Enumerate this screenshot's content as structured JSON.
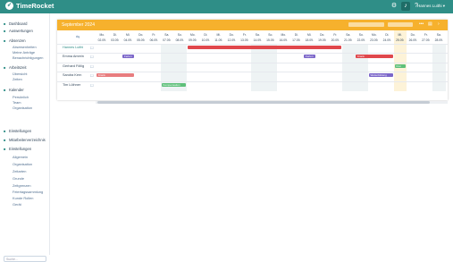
{
  "app": {
    "name": "TimeRocket",
    "user": "Hannes Luithi"
  },
  "sidebar": {
    "items": [
      {
        "label": "Dashboard",
        "icon": "home-icon",
        "sub": false
      },
      {
        "label": "Auswertungen",
        "icon": "chart-icon",
        "sub": false
      },
      {
        "label": "Absenzen",
        "icon": "calendar-icon",
        "sub": false
      },
      {
        "label": "Abwesenheiten",
        "icon": "",
        "sub": true
      },
      {
        "label": "Meine Anträge",
        "icon": "",
        "sub": true
      },
      {
        "label": "Benachrichtigungen",
        "icon": "",
        "sub": true
      },
      {
        "label": "Arbeitszeit",
        "icon": "clock-icon",
        "sub": false
      },
      {
        "label": "Übersicht",
        "icon": "",
        "sub": true
      },
      {
        "label": "Zeiten",
        "icon": "",
        "sub": true
      },
      {
        "label": "Kalender",
        "icon": "calendar-icon",
        "sub": false
      },
      {
        "label": "Persönlich",
        "icon": "",
        "sub": true
      },
      {
        "label": "Team",
        "icon": "",
        "sub": true
      },
      {
        "label": "Organisation",
        "icon": "",
        "sub": true
      },
      {
        "label": "Einstellungen",
        "icon": "settings-icon",
        "sub": false
      },
      {
        "label": "Mitarbeiterverzeichnis",
        "icon": "users-icon",
        "sub": false
      },
      {
        "label": "Einstellungen",
        "icon": "gear-icon",
        "sub": false
      },
      {
        "label": "Allgemein",
        "icon": "",
        "sub": true
      },
      {
        "label": "Organisation",
        "icon": "",
        "sub": true
      },
      {
        "label": "Zeitarten",
        "icon": "",
        "sub": true
      },
      {
        "label": "Grunde",
        "icon": "",
        "sub": true
      },
      {
        "label": "Zeitgrenzen",
        "icon": "",
        "sub": true
      },
      {
        "label": "Feiertagssammlung",
        "icon": "",
        "sub": true
      },
      {
        "label": "Kunde Rollen",
        "icon": "",
        "sub": true
      },
      {
        "label": "Gerät",
        "icon": "",
        "sub": true
      }
    ],
    "search_placeholder": "Suche..."
  },
  "calendar": {
    "month": "September 2024",
    "days": [
      {
        "wd": "Mo.",
        "d": "02.09."
      },
      {
        "wd": "Di.",
        "d": "03.09."
      },
      {
        "wd": "Mi.",
        "d": "04.09."
      },
      {
        "wd": "Do.",
        "d": "05.09."
      },
      {
        "wd": "Fr.",
        "d": "06.09."
      },
      {
        "wd": "Sa.",
        "d": "07.09."
      },
      {
        "wd": "So.",
        "d": "08.09."
      },
      {
        "wd": "Mo.",
        "d": "09.09."
      },
      {
        "wd": "Di.",
        "d": "10.09."
      },
      {
        "wd": "Mi.",
        "d": "11.09."
      },
      {
        "wd": "Do.",
        "d": "12.09."
      },
      {
        "wd": "Fr.",
        "d": "13.09."
      },
      {
        "wd": "Sa.",
        "d": "14.09."
      },
      {
        "wd": "So.",
        "d": "15.09."
      },
      {
        "wd": "Mo.",
        "d": "16.09."
      },
      {
        "wd": "Di.",
        "d": "17.09."
      },
      {
        "wd": "Mi.",
        "d": "18.09."
      },
      {
        "wd": "Do.",
        "d": "19.09."
      },
      {
        "wd": "Fr.",
        "d": "20.09."
      },
      {
        "wd": "Sa.",
        "d": "21.09."
      },
      {
        "wd": "So.",
        "d": "22.09."
      },
      {
        "wd": "Mo.",
        "d": "23.09."
      },
      {
        "wd": "Di.",
        "d": "24.09."
      },
      {
        "wd": "Mi.",
        "d": "25.09."
      },
      {
        "wd": "Do.",
        "d": "26.09."
      },
      {
        "wd": "Fr.",
        "d": "27.09."
      },
      {
        "wd": "Sa.",
        "d": "28.09."
      }
    ],
    "people": [
      "Hannes Luithi",
      "Emma Amrein",
      "Gerhard Föllig",
      "Sandra Kern",
      "Tim Lüthner"
    ],
    "bars": [
      {
        "row": 0,
        "start": 7,
        "len": 12,
        "color": "#e0474c",
        "label": ""
      },
      {
        "row": 1,
        "start": 2,
        "len": 1,
        "color": "#7b66c9",
        "label": "Ferien"
      },
      {
        "row": 1,
        "start": 16,
        "len": 1,
        "color": "#7b66c9",
        "label": "Ferien"
      },
      {
        "row": 1,
        "start": 20,
        "len": 3,
        "color": "#e0474c",
        "label": "Krank"
      },
      {
        "row": 2,
        "start": 23,
        "len": 1,
        "color": "#5ec07a",
        "label": "Frei"
      },
      {
        "row": 3,
        "start": 0,
        "len": 3,
        "color": "#e87d7f",
        "label": "Krank"
      },
      {
        "row": 3,
        "start": 21,
        "len": 2,
        "color": "#7b66c9",
        "label": "Weiterbildung"
      },
      {
        "row": 4,
        "start": 5,
        "len": 2,
        "color": "#5ec07a",
        "label": "Kompensation"
      }
    ]
  }
}
